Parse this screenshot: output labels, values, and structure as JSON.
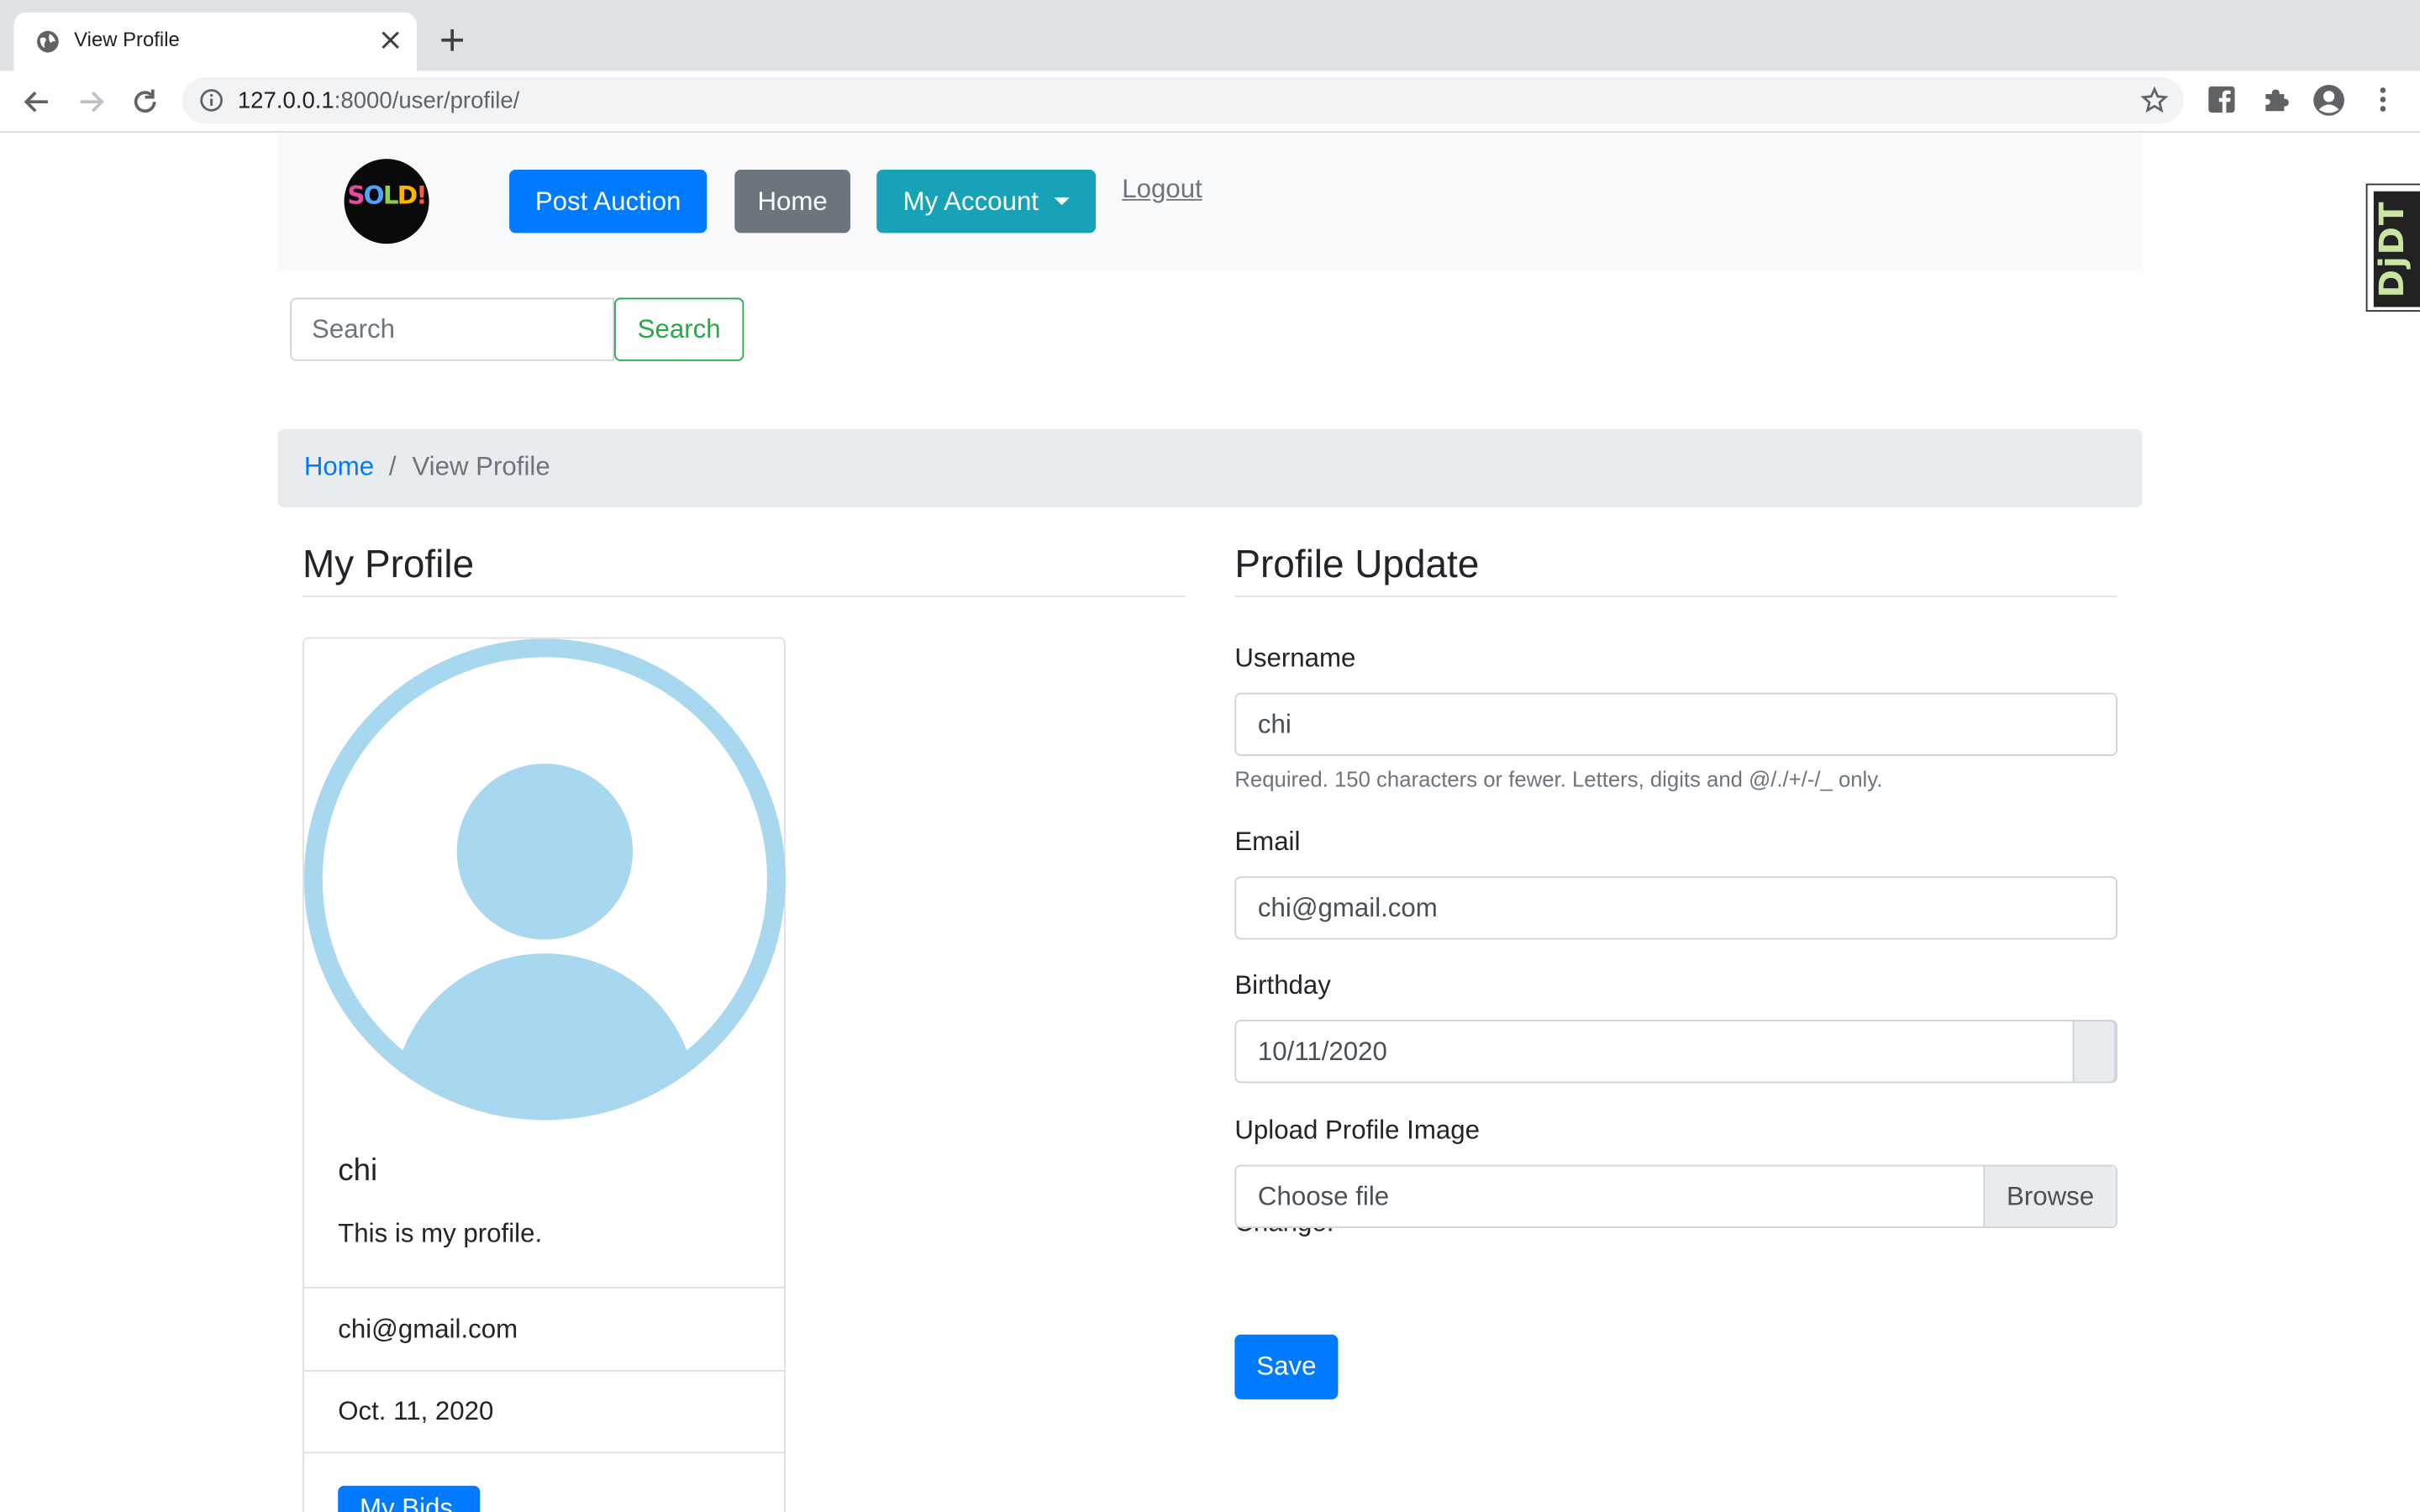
{
  "browser": {
    "tab_title": "View Profile",
    "url_host": "127.0.0.1",
    "url_rest": ":8000/user/profile/"
  },
  "navbar": {
    "logo_text": "SOLD!",
    "post_auction": "Post Auction",
    "home": "Home",
    "my_account": "My Account",
    "logout": "Logout"
  },
  "search": {
    "placeholder": "Search",
    "button": "Search"
  },
  "breadcrumb": {
    "home": "Home",
    "separator": "/",
    "current": "View Profile"
  },
  "profile": {
    "heading": "My Profile",
    "name": "chi",
    "bio": "This is my profile.",
    "email": "chi@gmail.com",
    "birthday": "Oct. 11, 2020",
    "button": "My Bids"
  },
  "form": {
    "heading": "Profile Update",
    "username_label": "Username",
    "username_value": "chi",
    "username_help": "Required. 150 characters or fewer. Letters, digits and @/./+/-/_ only.",
    "email_label": "Email",
    "email_value": "chi@gmail.com",
    "birthday_label": "Birthday",
    "birthday_value": "10/11/2020",
    "upload_label": "Upload Profile Image",
    "file_placeholder": "Choose file",
    "browse": "Browse",
    "change_text": "Change:",
    "save": "Save"
  },
  "debug_toolbar": {
    "label": "DjDT"
  },
  "colors": {
    "primary": "#007bff",
    "secondary": "#6c757d",
    "info": "#17a2b8",
    "success": "#28a745",
    "avatar": "#a8d8f0"
  }
}
